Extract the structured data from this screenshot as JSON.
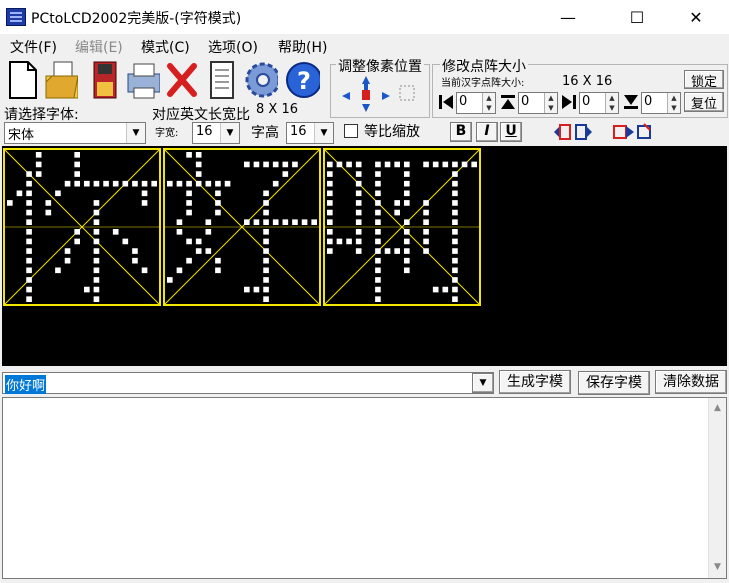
{
  "window": {
    "title": "PCtoLCD2002完美版-(字符模式)",
    "minimize": "—",
    "maximize": "☐",
    "close": "✕"
  },
  "menu": [
    {
      "label": "文件(F)",
      "enabled": true
    },
    {
      "label": "编辑(E)",
      "enabled": false
    },
    {
      "label": "模式(C)",
      "enabled": true
    },
    {
      "label": "选项(O)",
      "enabled": true
    },
    {
      "label": "帮助(H)",
      "enabled": true
    }
  ],
  "toolbar": {
    "icons": [
      "new-file-icon",
      "open-folder-icon",
      "save-disk-icon",
      "print-icon",
      "delete-x-icon",
      "notepad-icon",
      "settings-gear-icon",
      "help-icon"
    ]
  },
  "adjust_group": {
    "title": "调整像素位置"
  },
  "resize_group": {
    "title": "修改点阵大小",
    "current_label": "当前汉字点阵大小:",
    "current_value": "16 X 16",
    "lock_button": "锁定",
    "reset_button": "复位",
    "spins": [
      "0",
      "0",
      "0",
      "0"
    ]
  },
  "font_panel": {
    "choose_label": "请选择字体:",
    "ratio_label": "对应英文长宽比",
    "ratio_value": "8 X 16",
    "font_value": "宋体",
    "width_label": "字宽:",
    "width_value": "16",
    "height_label": "字高",
    "height_value": "16",
    "scale_label": "等比缩放",
    "bold": "B",
    "italic": "I",
    "underline": "U"
  },
  "input": {
    "text": "你好啊"
  },
  "buttons": {
    "generate": "生成字模",
    "save": "保存字模",
    "clear": "清除数据"
  },
  "colors": {
    "canvas": "#000000",
    "grid": "#f2e600",
    "dot": "#ffffff",
    "selection": "#0078d7",
    "underline_mark": "#e02020"
  }
}
